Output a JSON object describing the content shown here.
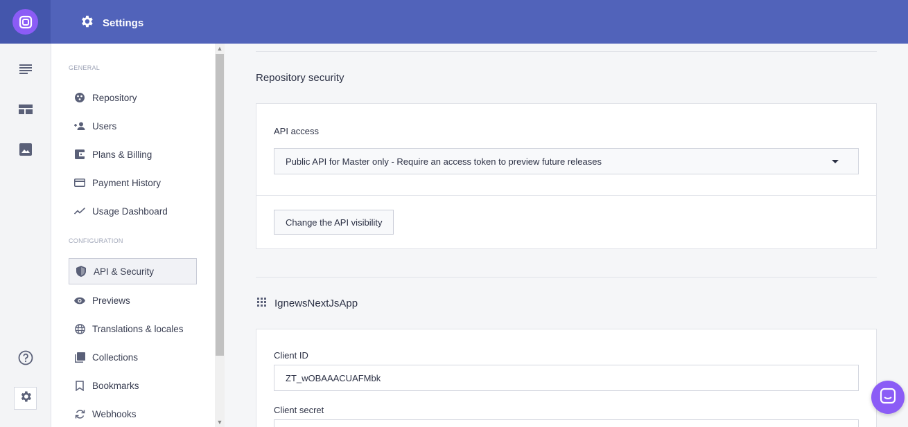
{
  "header": {
    "title": "Settings",
    "icon": "gear-icon"
  },
  "rail": {
    "items": [
      {
        "name": "documents-icon"
      },
      {
        "name": "custom-types-icon"
      },
      {
        "name": "media-icon"
      }
    ],
    "help_icon": "help-icon",
    "settings_icon": "gear-icon"
  },
  "nav": {
    "sections": [
      {
        "label": "GENERAL"
      },
      {
        "label": "CONFIGURATION"
      }
    ],
    "items": [
      {
        "label": "Repository",
        "icon": "repository-icon"
      },
      {
        "label": "Users",
        "icon": "add-user-icon"
      },
      {
        "label": "Plans & Billing",
        "icon": "wallet-icon"
      },
      {
        "label": "Payment History",
        "icon": "credit-card-icon"
      },
      {
        "label": "Usage Dashboard",
        "icon": "trend-icon"
      },
      {
        "label": "API & Security",
        "icon": "shield-icon",
        "active": true
      },
      {
        "label": "Previews",
        "icon": "eye-icon"
      },
      {
        "label": "Translations & locales",
        "icon": "globe-icon"
      },
      {
        "label": "Collections",
        "icon": "collections-icon"
      },
      {
        "label": "Bookmarks",
        "icon": "bookmark-icon"
      },
      {
        "label": "Webhooks",
        "icon": "sync-icon"
      }
    ]
  },
  "security": {
    "title": "Repository security",
    "api_access_label": "API access",
    "api_access_value": "Public API for Master only - Require an access token to preview future releases",
    "change_button": "Change the API visibility"
  },
  "app": {
    "name": "IgnewsNextJsApp",
    "client_id_label": "Client ID",
    "client_id_value": "ZT_wOBAAACUAFMbk",
    "client_secret_label": "Client secret"
  },
  "colors": {
    "header": "#5163ba",
    "accent": "#8b5cf6"
  }
}
